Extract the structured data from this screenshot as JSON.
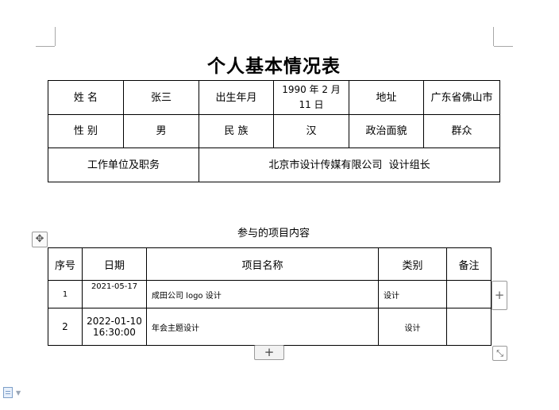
{
  "document": {
    "title": "个人基本情况表"
  },
  "personal_info": {
    "row1": {
      "name_label": "姓 名",
      "name_value": "张三",
      "birth_label": "出生年月",
      "birth_value": "1990 年 2 月 11 日",
      "address_label": "地址",
      "address_value": "广东省佛山市"
    },
    "row2": {
      "gender_label": "性 别",
      "gender_value": "男",
      "ethnicity_label": "民 族",
      "ethnicity_value": "汉",
      "political_label": "政治面貌",
      "political_value": "群众"
    },
    "row3": {
      "work_label": "工作单位及职务",
      "work_value": "北京市设计传媒有限公司  设计组长"
    }
  },
  "projects": {
    "section_title": "参与的项目内容",
    "headers": {
      "index": "序号",
      "date": "日期",
      "name": "项目名称",
      "category": "类别",
      "remark": "备注"
    },
    "rows": [
      {
        "index": "1",
        "date": "2021-05-17",
        "name": "成田公司 logo 设计",
        "category": "设计",
        "remark": ""
      },
      {
        "index": "2",
        "date_line1": "2022-01-10",
        "date_line2": "16:30:00",
        "name": "年会主题设计",
        "category": "设计",
        "remark": ""
      }
    ]
  },
  "controls": {
    "move_glyph": "✥",
    "add_column_glyph": "+",
    "add_row_glyph": "+",
    "resize_glyph": "⤡",
    "status_caret_glyph": "▼",
    "icons": [
      "table-move-icon",
      "add-column-icon",
      "add-row-icon",
      "table-resize-icon",
      "document-icon"
    ]
  }
}
